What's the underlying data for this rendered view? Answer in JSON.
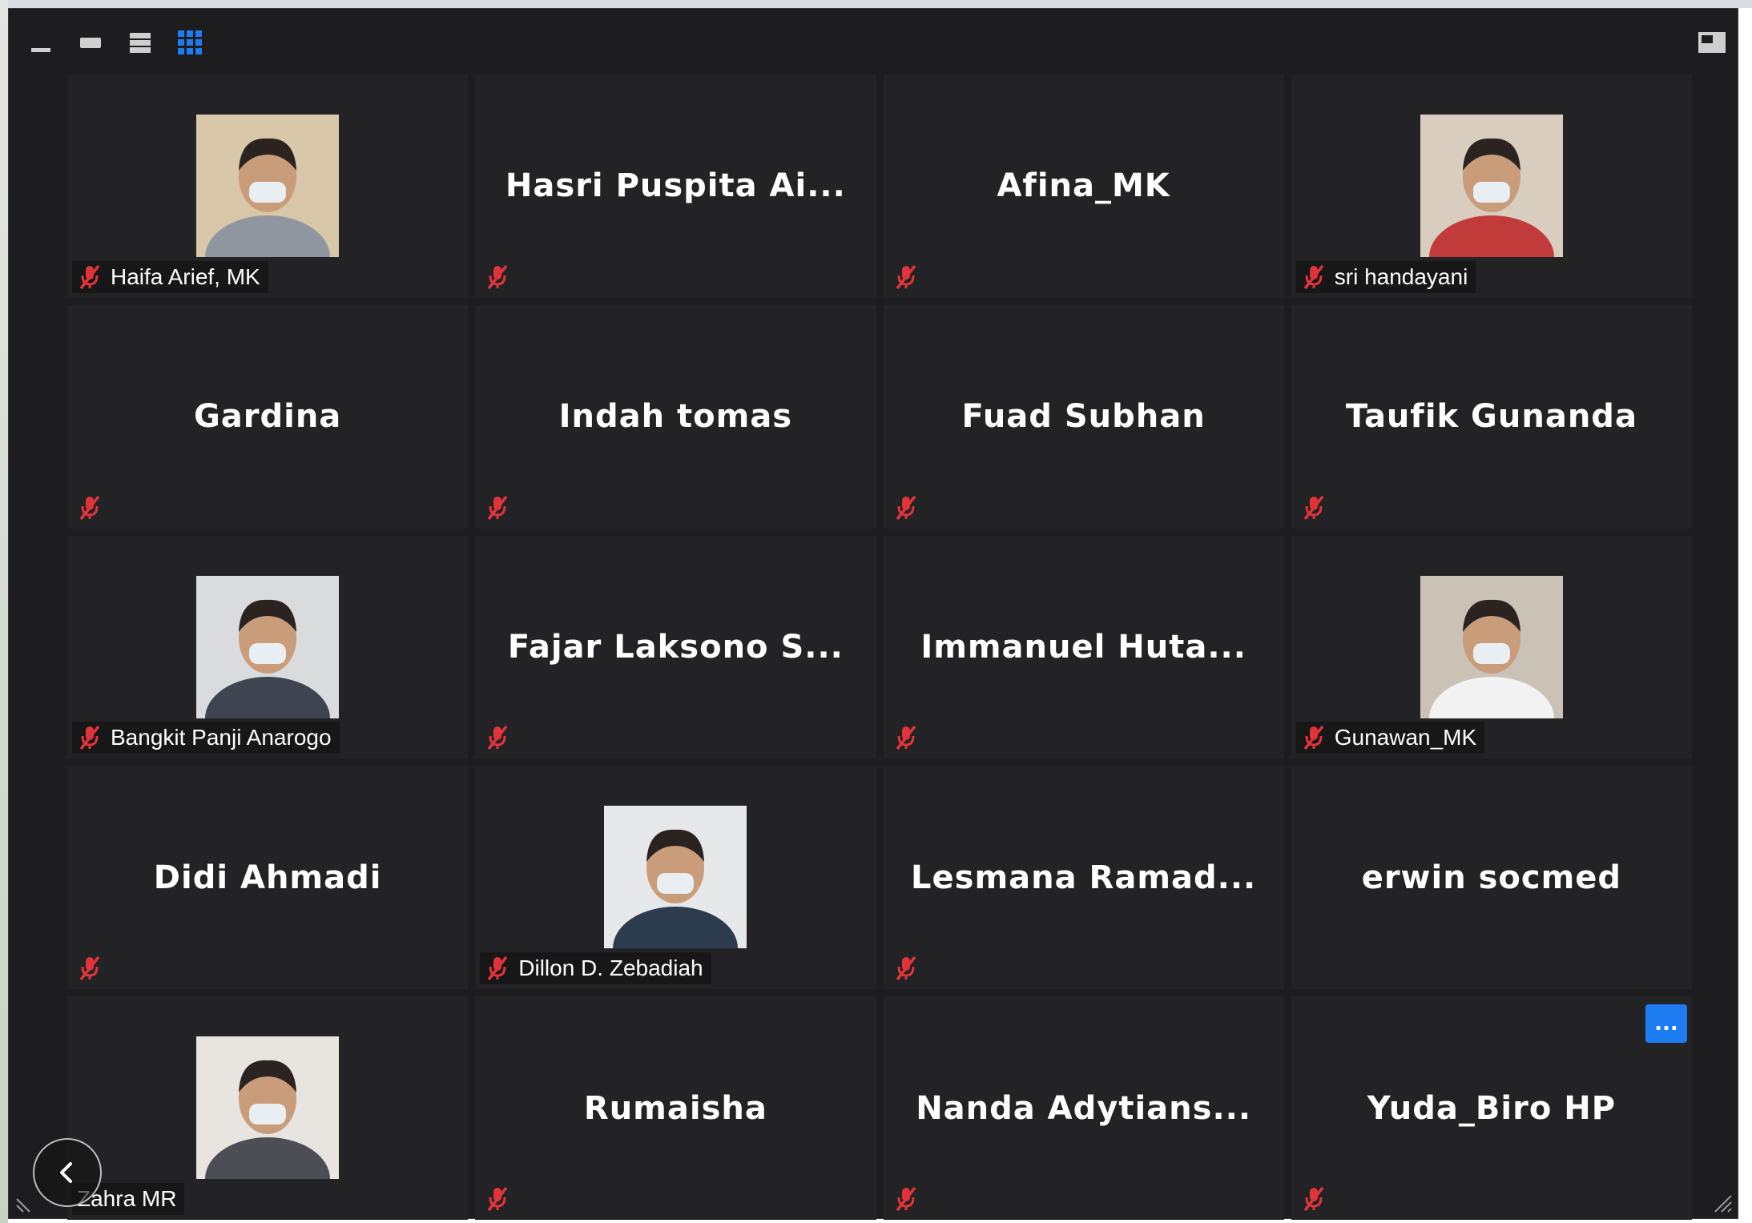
{
  "toolbar": {
    "icons": [
      "minimize-icon",
      "speaker-view-icon",
      "strip-view-icon",
      "gallery-view-icon",
      "exit-fullscreen-icon"
    ],
    "active_view": "gallery-view-icon",
    "accent_color": "#1e7cf2"
  },
  "participants": [
    {
      "name": "Haifa Arief, MK",
      "display": "",
      "video": true,
      "muted": true
    },
    {
      "name": "",
      "display": "Hasri  Puspita  Ai...",
      "video": false,
      "muted": true
    },
    {
      "name": "",
      "display": "Afina_MK",
      "video": false,
      "muted": true
    },
    {
      "name": "sri handayani",
      "display": "",
      "video": true,
      "muted": true
    },
    {
      "name": "",
      "display": "Gardina",
      "video": false,
      "muted": true
    },
    {
      "name": "",
      "display": "Indah tomas",
      "video": false,
      "muted": true
    },
    {
      "name": "",
      "display": "Fuad Subhan",
      "video": false,
      "muted": true
    },
    {
      "name": "",
      "display": "Taufik Gunanda",
      "video": false,
      "muted": true
    },
    {
      "name": "Bangkit Panji Anarogo",
      "display": "",
      "video": true,
      "muted": true
    },
    {
      "name": "",
      "display": "Fajar  Laksono  S...",
      "video": false,
      "muted": true
    },
    {
      "name": "",
      "display": "Immanuel  Huta...",
      "video": false,
      "muted": true
    },
    {
      "name": "Gunawan_MK",
      "display": "",
      "video": true,
      "muted": true
    },
    {
      "name": "",
      "display": "Didi Ahmadi",
      "video": false,
      "muted": true
    },
    {
      "name": "Dillon D. Zebadiah",
      "display": "",
      "video": true,
      "muted": true
    },
    {
      "name": "",
      "display": "Lesmana  Ramad...",
      "video": false,
      "muted": true
    },
    {
      "name": "",
      "display": "erwin socmed",
      "video": false,
      "muted": false
    },
    {
      "name": "Zahra MR",
      "display": "",
      "video": true,
      "muted": false
    },
    {
      "name": "",
      "display": "Rumaisha",
      "video": false,
      "muted": true
    },
    {
      "name": "",
      "display": "Nanda  Adytians...",
      "video": false,
      "muted": true
    },
    {
      "name": "",
      "display": "Yuda_Biro HP",
      "video": false,
      "muted": true,
      "more": true
    }
  ],
  "more_button_label": "...",
  "mute_color": "#e0343a"
}
